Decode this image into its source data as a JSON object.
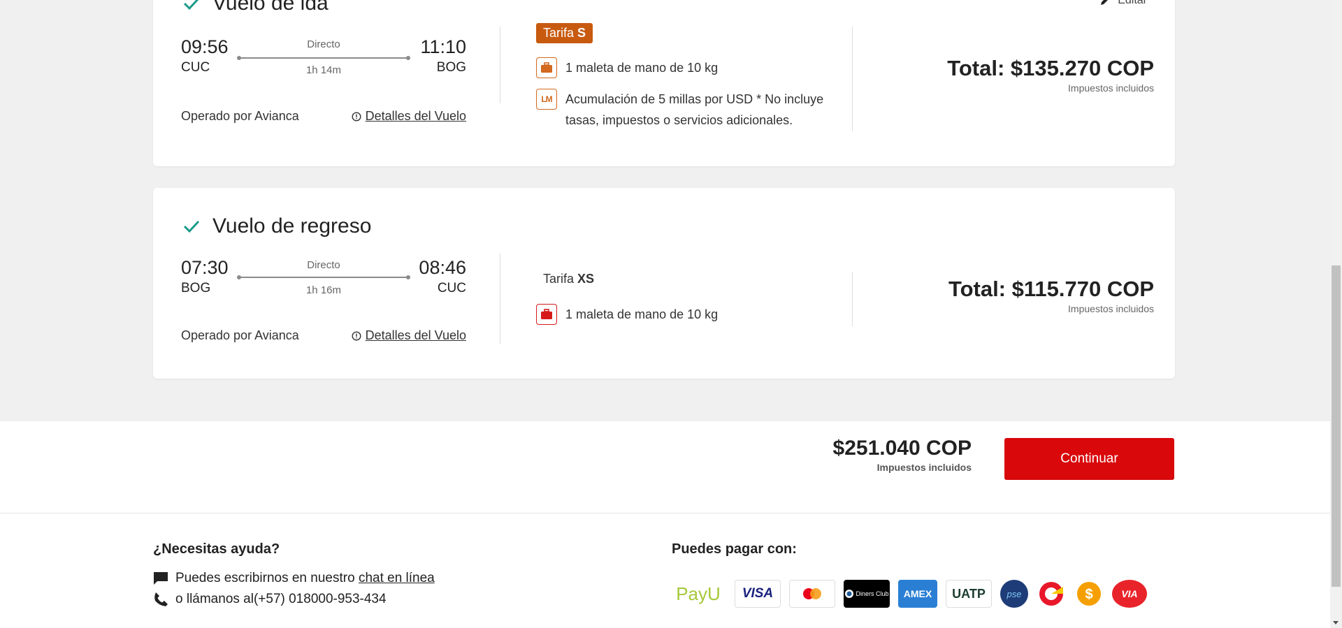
{
  "outbound": {
    "title": "Vuelo de ida",
    "edit_label": "Editar",
    "dep_time": "09:56",
    "dep_code": "CUC",
    "arr_time": "11:10",
    "arr_code": "BOG",
    "stops": "Directo",
    "duration": "1h 14m",
    "operator": "Operado por Avianca",
    "details_label": "Detalles del Vuelo",
    "fare_prefix": "Tarifa",
    "fare_code": "S",
    "benefits": [
      "1 maleta de mano de 10 kg",
      "Acumulación de 5 millas por USD * No incluye",
      "tasas, impuestos o servicios adicionales."
    ],
    "lm_badge": "LM",
    "total": "Total: $135.270 COP",
    "taxes_note": "Impuestos incluidos"
  },
  "return": {
    "title": "Vuelo de regreso",
    "dep_time": "07:30",
    "dep_code": "BOG",
    "arr_time": "08:46",
    "arr_code": "CUC",
    "stops": "Directo",
    "duration": "1h 16m",
    "operator": "Operado por Avianca",
    "details_label": "Detalles del Vuelo",
    "fare_prefix": "Tarifa",
    "fare_code": "XS",
    "benefits": [
      "1 maleta de mano de 10 kg"
    ],
    "total": "Total: $115.770 COP",
    "taxes_note": "Impuestos incluidos"
  },
  "summary": {
    "grand_total": "$251.040 COP",
    "taxes_note": "Impuestos incluidos",
    "continue_label": "Continuar"
  },
  "footer": {
    "help_title": "¿Necesitas ayuda?",
    "chat_prefix": "Puedes escribirnos en nuestro",
    "chat_link": "chat en línea",
    "phone_text": "o llámanos al(+57) 018000-953-434",
    "pay_title": "Puedes pagar con:",
    "pay_methods": [
      "PayU",
      "VISA",
      "Mastercard",
      "Diners Club",
      "AMEX",
      "UATP",
      "pse",
      "Efecty",
      "Baloto",
      "VIA"
    ]
  },
  "colors": {
    "accent_red": "#d8080b",
    "fare_orange": "#c85a10",
    "check_teal": "#1a9a8a"
  }
}
